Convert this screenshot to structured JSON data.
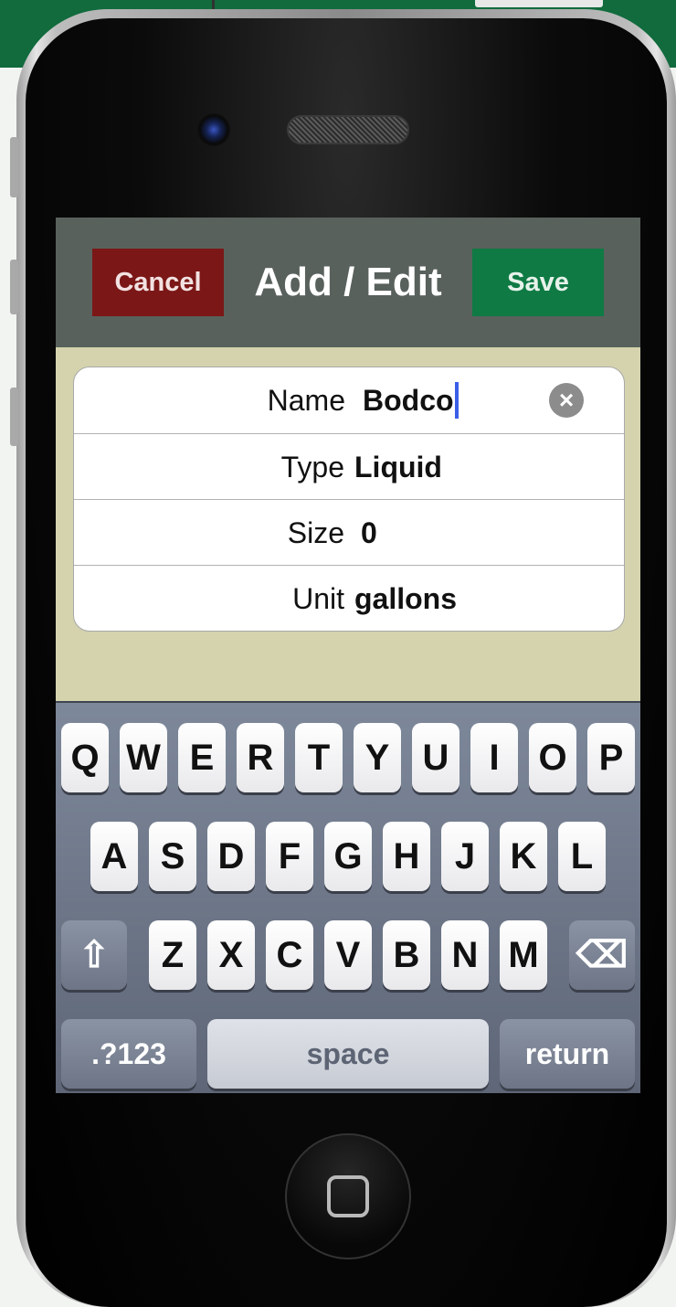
{
  "navbar": {
    "cancel_label": "Cancel",
    "title": "Add / Edit",
    "save_label": "Save"
  },
  "form": {
    "fields": [
      {
        "label": "Name",
        "value": "Bodco"
      },
      {
        "label": "Type",
        "value": "Liquid"
      },
      {
        "label": "Size",
        "value": "0"
      },
      {
        "label": "Unit",
        "value": "gallons"
      }
    ],
    "clear_icon": "×"
  },
  "keyboard": {
    "row1": [
      "Q",
      "W",
      "E",
      "R",
      "T",
      "Y",
      "U",
      "I",
      "O",
      "P"
    ],
    "row2": [
      "A",
      "S",
      "D",
      "F",
      "G",
      "H",
      "J",
      "K",
      "L"
    ],
    "row3": [
      "Z",
      "X",
      "C",
      "V",
      "B",
      "N",
      "M"
    ],
    "shift_icon": "⇧",
    "backspace_icon": "⌫",
    "numbers_label": ".?123",
    "space_label": "space",
    "return_label": "return"
  },
  "colors": {
    "cancel": "#7b1717",
    "save": "#0f7a44",
    "navbar": "#59615c",
    "background": "#d4d3ae",
    "cursor": "#3a5ee8"
  }
}
